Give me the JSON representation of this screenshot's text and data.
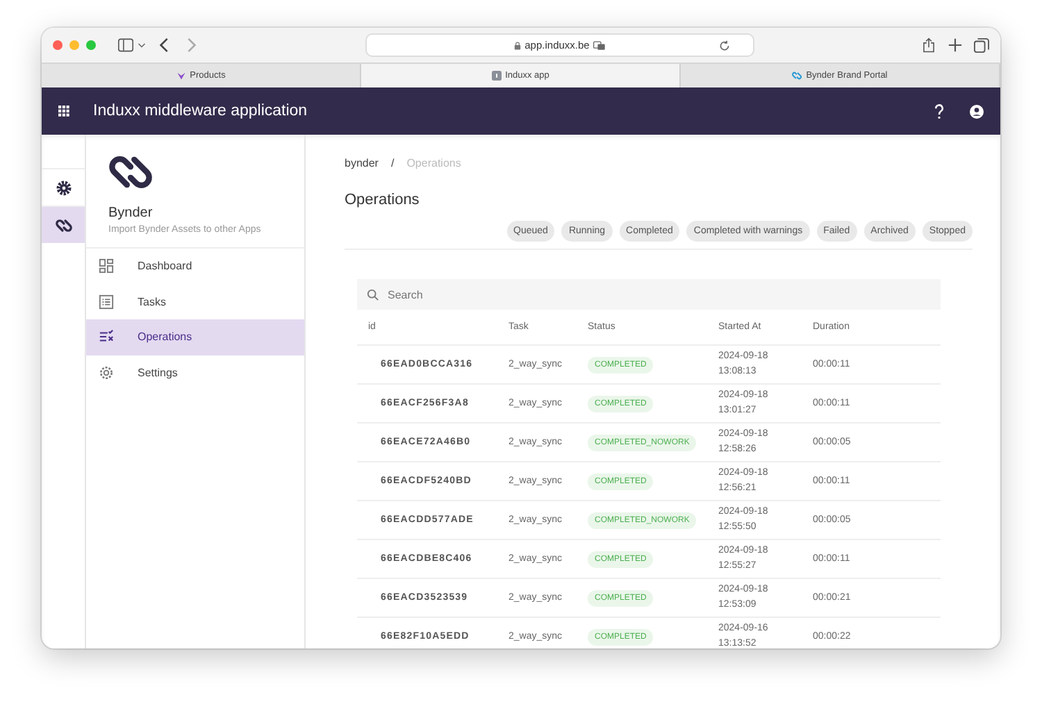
{
  "browser": {
    "address": "app.induxx.be",
    "tabs": [
      {
        "label": "Products",
        "selected": false,
        "kind": "products"
      },
      {
        "label": "Induxx app",
        "selected": true,
        "kind": "induxx"
      },
      {
        "label": "Bynder Brand Portal",
        "selected": false,
        "kind": "bynder"
      }
    ]
  },
  "app_bar": {
    "title": "Induxx middleware application"
  },
  "rail": [
    {
      "kind": "settings",
      "selected": false
    },
    {
      "kind": "bynder",
      "selected": true
    }
  ],
  "sidebar": {
    "title": "Bynder",
    "subtitle": "Import Bynder Assets to other Apps",
    "items": [
      {
        "label": "Dashboard",
        "kind": "dashboard",
        "selected": false
      },
      {
        "label": "Tasks",
        "kind": "tasks",
        "selected": false
      },
      {
        "label": "Operations",
        "kind": "operations",
        "selected": true
      },
      {
        "label": "Settings",
        "kind": "settings",
        "selected": false
      }
    ]
  },
  "breadcrumb": {
    "items": [
      "bynder",
      "Operations"
    ],
    "separator": "/"
  },
  "page_title": "Operations",
  "filters": [
    "Queued",
    "Running",
    "Completed",
    "Completed with warnings",
    "Failed",
    "Archived",
    "Stopped"
  ],
  "search": {
    "placeholder": "Search"
  },
  "table": {
    "columns": [
      "id",
      "Task",
      "Status",
      "Started At",
      "Duration"
    ],
    "rows": [
      {
        "id": "66EAD0BCCA316",
        "task": "2_way_sync",
        "status": "COMPLETED",
        "date": "2024-09-18",
        "time": "13:08:13",
        "duration": "00:00:11"
      },
      {
        "id": "66EACF256F3A8",
        "task": "2_way_sync",
        "status": "COMPLETED",
        "date": "2024-09-18",
        "time": "13:01:27",
        "duration": "00:00:11"
      },
      {
        "id": "66EACE72A46B0",
        "task": "2_way_sync",
        "status": "COMPLETED_NOWORK",
        "date": "2024-09-18",
        "time": "12:58:26",
        "duration": "00:00:05"
      },
      {
        "id": "66EACDF5240BD",
        "task": "2_way_sync",
        "status": "COMPLETED",
        "date": "2024-09-18",
        "time": "12:56:21",
        "duration": "00:00:11"
      },
      {
        "id": "66EACDD577ADE",
        "task": "2_way_sync",
        "status": "COMPLETED_NOWORK",
        "date": "2024-09-18",
        "time": "12:55:50",
        "duration": "00:00:05"
      },
      {
        "id": "66EACDBE8C406",
        "task": "2_way_sync",
        "status": "COMPLETED",
        "date": "2024-09-18",
        "time": "12:55:27",
        "duration": "00:00:11"
      },
      {
        "id": "66EACD3523539",
        "task": "2_way_sync",
        "status": "COMPLETED",
        "date": "2024-09-18",
        "time": "12:53:09",
        "duration": "00:00:21"
      },
      {
        "id": "66E82F10A5EDD",
        "task": "2_way_sync",
        "status": "COMPLETED",
        "date": "2024-09-16",
        "time": "13:13:52",
        "duration": "00:00:22"
      }
    ]
  }
}
